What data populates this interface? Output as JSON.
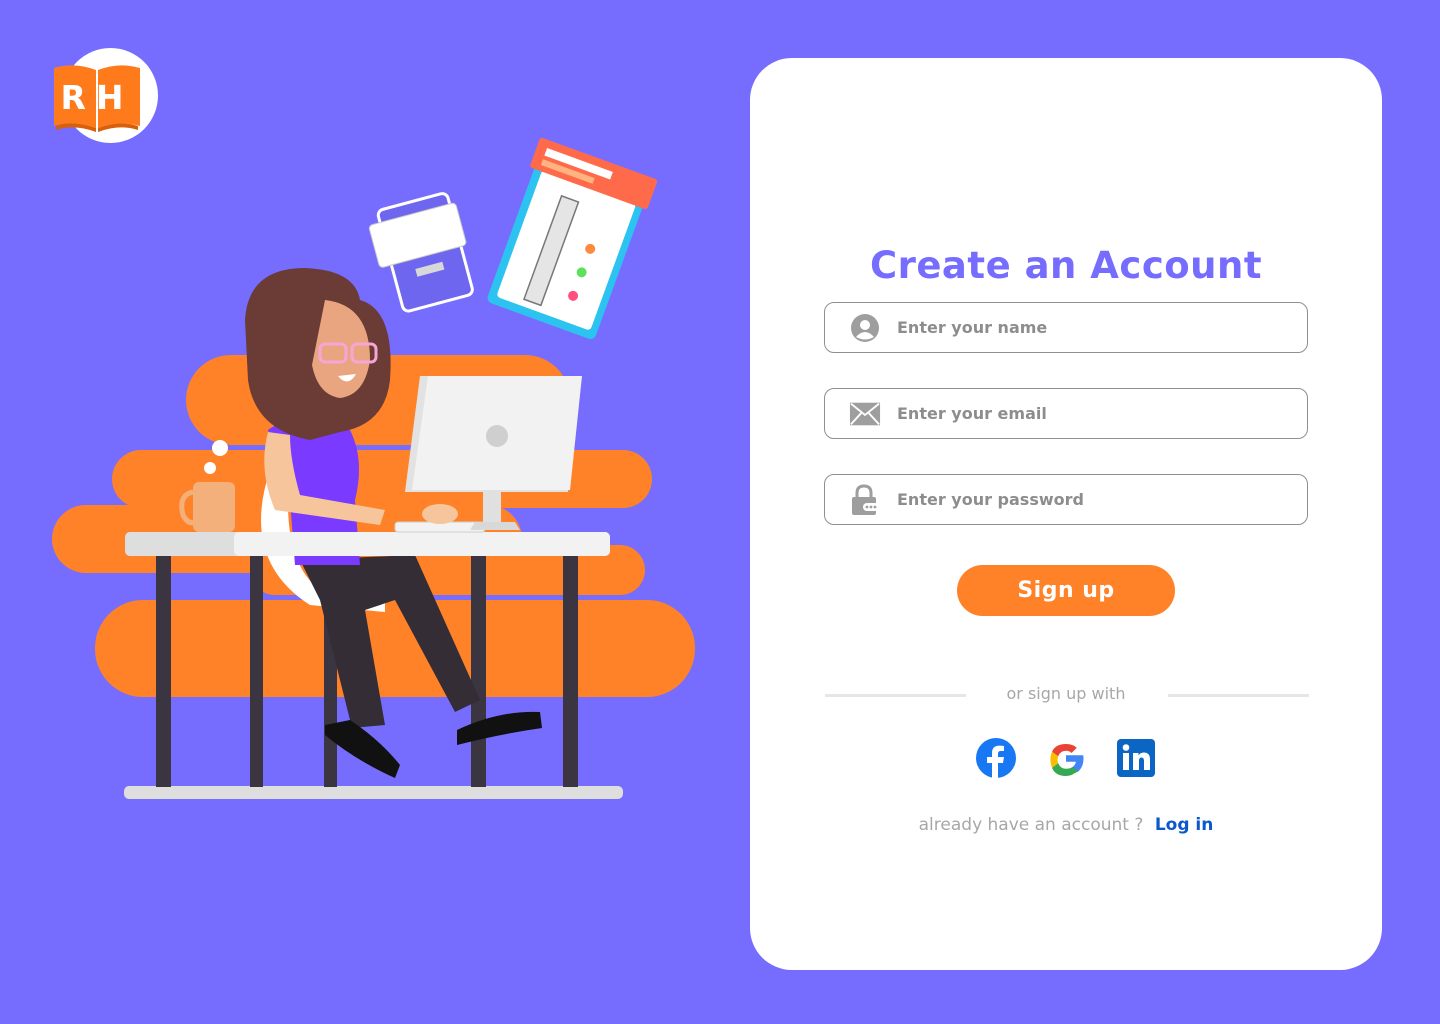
{
  "brand": {
    "logo_text": "RH",
    "logo_color": "#ff7a1a"
  },
  "colors": {
    "background": "#766dff",
    "accent": "#766dff",
    "button": "#ff8229",
    "link": "#0a58ca"
  },
  "form": {
    "title": "Create an Account",
    "fields": [
      {
        "icon": "user-icon",
        "placeholder": "Enter your name",
        "value": ""
      },
      {
        "icon": "mail-icon",
        "placeholder": "Enter your email",
        "value": ""
      },
      {
        "icon": "lock-icon",
        "placeholder": "Enter your password",
        "value": ""
      }
    ],
    "submit_label": "Sign up",
    "divider_text": "or sign up with",
    "socials": [
      {
        "icon": "facebook-icon"
      },
      {
        "icon": "google-icon"
      },
      {
        "icon": "linkedin-icon"
      }
    ],
    "login_prompt": "already have an account ?",
    "login_link": "Log in"
  }
}
